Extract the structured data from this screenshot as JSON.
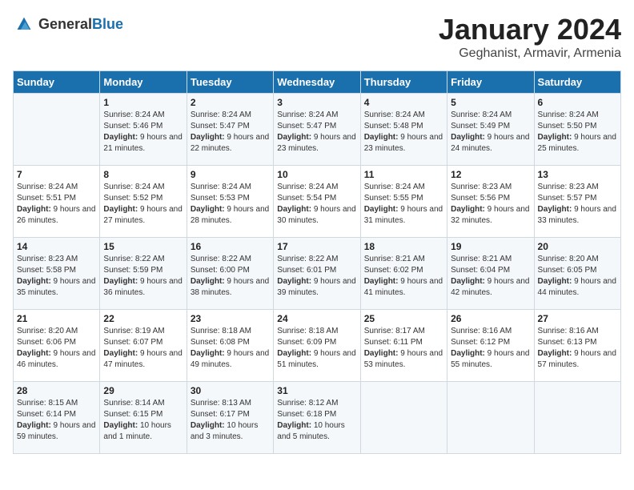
{
  "header": {
    "logo_general": "General",
    "logo_blue": "Blue",
    "month_title": "January 2024",
    "location": "Geghanist, Armavir, Armenia"
  },
  "days_of_week": [
    "Sunday",
    "Monday",
    "Tuesday",
    "Wednesday",
    "Thursday",
    "Friday",
    "Saturday"
  ],
  "weeks": [
    [
      {
        "day": "",
        "sunrise": "",
        "sunset": "",
        "daylight": ""
      },
      {
        "day": "1",
        "sunrise": "8:24 AM",
        "sunset": "5:46 PM",
        "daylight": "9 hours and 21 minutes."
      },
      {
        "day": "2",
        "sunrise": "8:24 AM",
        "sunset": "5:47 PM",
        "daylight": "9 hours and 22 minutes."
      },
      {
        "day": "3",
        "sunrise": "8:24 AM",
        "sunset": "5:47 PM",
        "daylight": "9 hours and 23 minutes."
      },
      {
        "day": "4",
        "sunrise": "8:24 AM",
        "sunset": "5:48 PM",
        "daylight": "9 hours and 23 minutes."
      },
      {
        "day": "5",
        "sunrise": "8:24 AM",
        "sunset": "5:49 PM",
        "daylight": "9 hours and 24 minutes."
      },
      {
        "day": "6",
        "sunrise": "8:24 AM",
        "sunset": "5:50 PM",
        "daylight": "9 hours and 25 minutes."
      }
    ],
    [
      {
        "day": "7",
        "sunrise": "8:24 AM",
        "sunset": "5:51 PM",
        "daylight": "9 hours and 26 minutes."
      },
      {
        "day": "8",
        "sunrise": "8:24 AM",
        "sunset": "5:52 PM",
        "daylight": "9 hours and 27 minutes."
      },
      {
        "day": "9",
        "sunrise": "8:24 AM",
        "sunset": "5:53 PM",
        "daylight": "9 hours and 28 minutes."
      },
      {
        "day": "10",
        "sunrise": "8:24 AM",
        "sunset": "5:54 PM",
        "daylight": "9 hours and 30 minutes."
      },
      {
        "day": "11",
        "sunrise": "8:24 AM",
        "sunset": "5:55 PM",
        "daylight": "9 hours and 31 minutes."
      },
      {
        "day": "12",
        "sunrise": "8:23 AM",
        "sunset": "5:56 PM",
        "daylight": "9 hours and 32 minutes."
      },
      {
        "day": "13",
        "sunrise": "8:23 AM",
        "sunset": "5:57 PM",
        "daylight": "9 hours and 33 minutes."
      }
    ],
    [
      {
        "day": "14",
        "sunrise": "8:23 AM",
        "sunset": "5:58 PM",
        "daylight": "9 hours and 35 minutes."
      },
      {
        "day": "15",
        "sunrise": "8:22 AM",
        "sunset": "5:59 PM",
        "daylight": "9 hours and 36 minutes."
      },
      {
        "day": "16",
        "sunrise": "8:22 AM",
        "sunset": "6:00 PM",
        "daylight": "9 hours and 38 minutes."
      },
      {
        "day": "17",
        "sunrise": "8:22 AM",
        "sunset": "6:01 PM",
        "daylight": "9 hours and 39 minutes."
      },
      {
        "day": "18",
        "sunrise": "8:21 AM",
        "sunset": "6:02 PM",
        "daylight": "9 hours and 41 minutes."
      },
      {
        "day": "19",
        "sunrise": "8:21 AM",
        "sunset": "6:04 PM",
        "daylight": "9 hours and 42 minutes."
      },
      {
        "day": "20",
        "sunrise": "8:20 AM",
        "sunset": "6:05 PM",
        "daylight": "9 hours and 44 minutes."
      }
    ],
    [
      {
        "day": "21",
        "sunrise": "8:20 AM",
        "sunset": "6:06 PM",
        "daylight": "9 hours and 46 minutes."
      },
      {
        "day": "22",
        "sunrise": "8:19 AM",
        "sunset": "6:07 PM",
        "daylight": "9 hours and 47 minutes."
      },
      {
        "day": "23",
        "sunrise": "8:18 AM",
        "sunset": "6:08 PM",
        "daylight": "9 hours and 49 minutes."
      },
      {
        "day": "24",
        "sunrise": "8:18 AM",
        "sunset": "6:09 PM",
        "daylight": "9 hours and 51 minutes."
      },
      {
        "day": "25",
        "sunrise": "8:17 AM",
        "sunset": "6:11 PM",
        "daylight": "9 hours and 53 minutes."
      },
      {
        "day": "26",
        "sunrise": "8:16 AM",
        "sunset": "6:12 PM",
        "daylight": "9 hours and 55 minutes."
      },
      {
        "day": "27",
        "sunrise": "8:16 AM",
        "sunset": "6:13 PM",
        "daylight": "9 hours and 57 minutes."
      }
    ],
    [
      {
        "day": "28",
        "sunrise": "8:15 AM",
        "sunset": "6:14 PM",
        "daylight": "9 hours and 59 minutes."
      },
      {
        "day": "29",
        "sunrise": "8:14 AM",
        "sunset": "6:15 PM",
        "daylight": "10 hours and 1 minute."
      },
      {
        "day": "30",
        "sunrise": "8:13 AM",
        "sunset": "6:17 PM",
        "daylight": "10 hours and 3 minutes."
      },
      {
        "day": "31",
        "sunrise": "8:12 AM",
        "sunset": "6:18 PM",
        "daylight": "10 hours and 5 minutes."
      },
      {
        "day": "",
        "sunrise": "",
        "sunset": "",
        "daylight": ""
      },
      {
        "day": "",
        "sunrise": "",
        "sunset": "",
        "daylight": ""
      },
      {
        "day": "",
        "sunrise": "",
        "sunset": "",
        "daylight": ""
      }
    ]
  ]
}
